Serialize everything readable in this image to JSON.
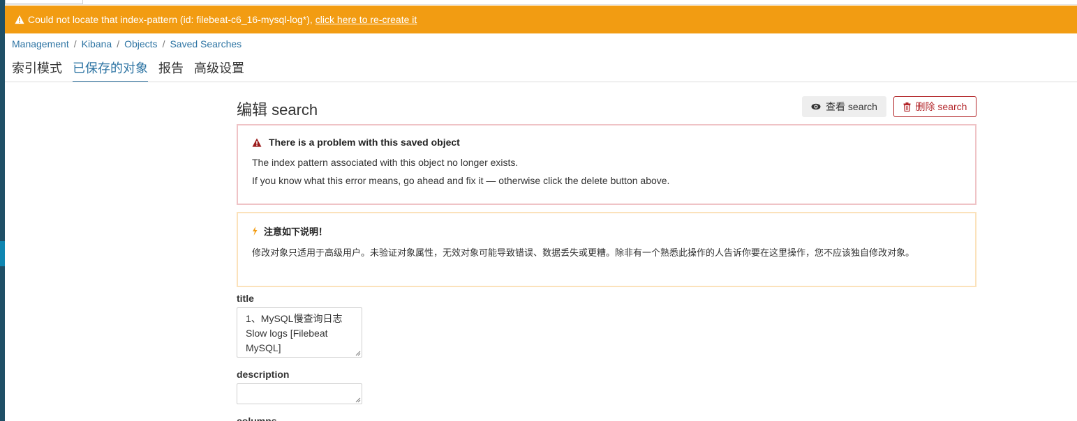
{
  "banner": {
    "message": "Could not locate that index-pattern (id: filebeat-c6_16-mysql-log*),",
    "link": "click here to re-create it"
  },
  "breadcrumb": {
    "items": [
      "Management",
      "Kibana",
      "Objects",
      "Saved Searches"
    ],
    "separator": "/"
  },
  "tabs": [
    {
      "label": "索引模式",
      "active": false
    },
    {
      "label": "已保存的对象",
      "active": true
    },
    {
      "label": "报告",
      "active": false
    },
    {
      "label": "高级设置",
      "active": false
    }
  ],
  "page": {
    "title": "编辑 search",
    "view_button": "查看 search",
    "delete_button": "删除 search"
  },
  "danger_alert": {
    "title": "There is a problem with this saved object",
    "line1": "The index pattern associated with this object no longer exists.",
    "line2": "If you know what this error means, go ahead and fix it — otherwise click the delete button above."
  },
  "warning_alert": {
    "title": "注意如下说明！",
    "body": "修改对象只适用于高级用户。未验证对象属性，无效对象可能导致错误、数据丢失或更糟。除非有一个熟悉此操作的人告诉你要在这里操作，您不应该独自修改对象。"
  },
  "fields": {
    "title_label": "title",
    "title_value": "1、MySQL慢查询日志 Slow logs [Filebeat MySQL]",
    "description_label": "description",
    "description_value": "",
    "columns_label": "columns"
  },
  "colors": {
    "banner": "#f29c12",
    "link": "#2d74a3",
    "danger": "#b3272b",
    "rail": "#1f4f66"
  }
}
